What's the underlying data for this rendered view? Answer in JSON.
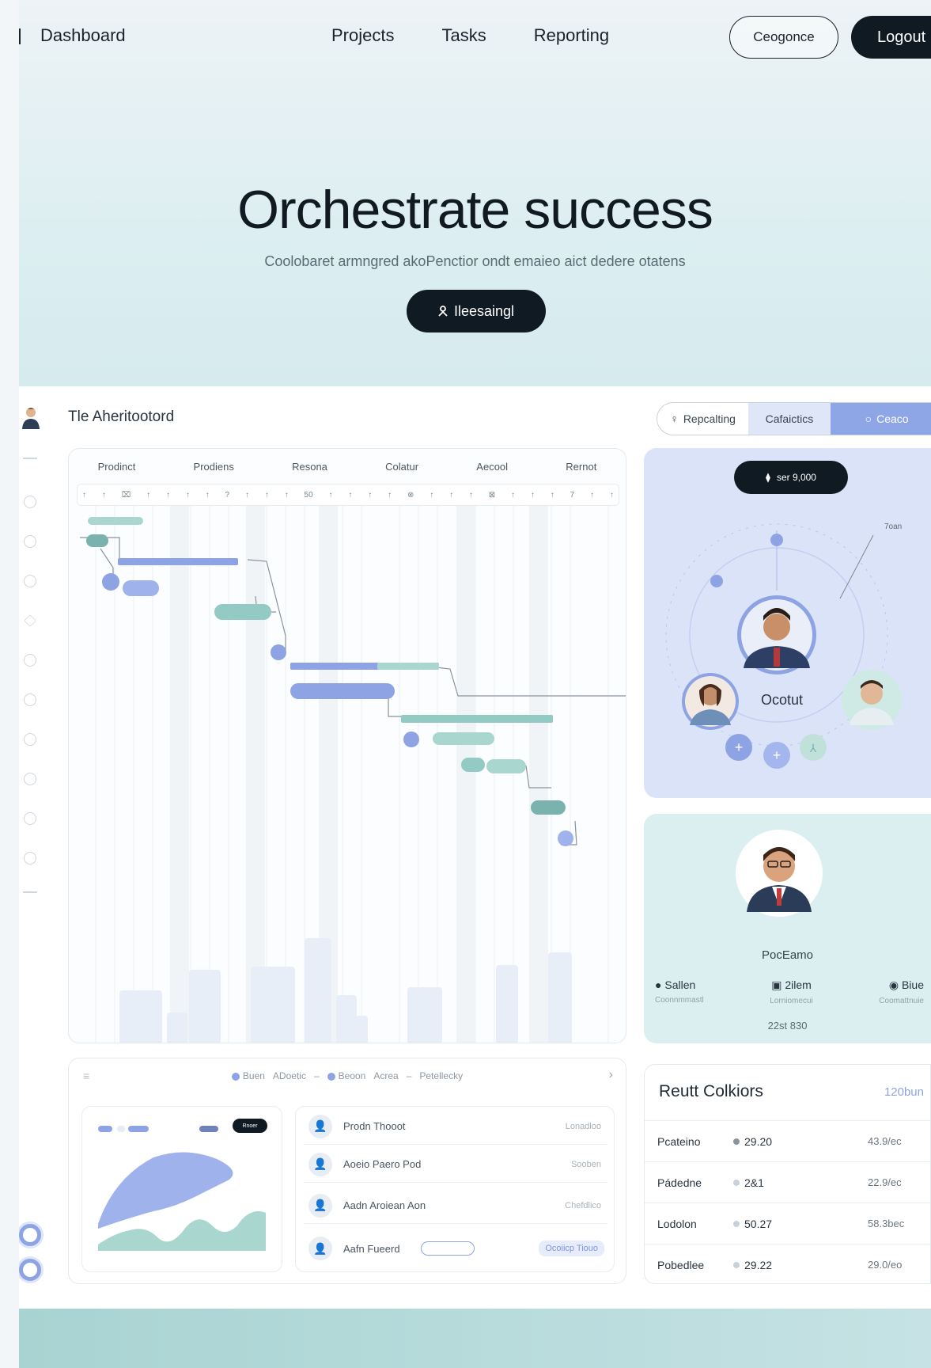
{
  "nav": {
    "brand": "Dashboard",
    "links": [
      "Projects",
      "Tasks",
      "Reporting"
    ],
    "outline_button": "Ceogonce",
    "dark_button": "Logout"
  },
  "hero": {
    "title": "Orchestrate success",
    "subtitle": "Coolobaret armngred akoPenctior ondt emaieo aict dedere otatens",
    "cta_label": "Ileesaingl",
    "cta_icon": "person-icon"
  },
  "dashboard": {
    "title": "Tle Aheritootord",
    "segments": [
      "Repcalting",
      "Cafaictics",
      "Ceaco"
    ],
    "gantt": {
      "columns": [
        "Prodinct",
        "Prodiens",
        "Resona",
        "Colatur",
        "Aecool",
        "Rernot"
      ],
      "tick_marks": [
        "↑",
        "↑",
        "⌧",
        "↑",
        "↑",
        "↑",
        "↑",
        "?",
        "↑",
        "↑",
        "↑",
        "50",
        "↑",
        "↑",
        "↑",
        "↑",
        "⊗",
        "↑",
        "↑",
        "↑",
        "⊠",
        "↑",
        "↑",
        "↑",
        "7",
        "↑",
        "↑"
      ]
    },
    "orbit": {
      "pill_text": "ser 9,000",
      "center_label": "Ocotut",
      "corner_label": "7oan"
    },
    "profile": {
      "name": "PocEamo",
      "stats": [
        {
          "icon": "person-icon",
          "label": "Sallen",
          "sub": "Coonnmmastl"
        },
        {
          "icon": "calendar-icon",
          "label": "2ilem",
          "sub": "Lorniomecui"
        },
        {
          "icon": "chat-icon",
          "label": "Biue",
          "sub": "Coomattnuie"
        }
      ],
      "footer": "22st 830"
    },
    "bottom": {
      "legend": [
        "Buen",
        "ADoetic",
        "Beoon",
        "Acrea",
        "Petellecky"
      ],
      "mini_badge": "Rnoer",
      "list": [
        {
          "name": "Prodn Thooot",
          "secondary": "Lonadloo"
        },
        {
          "name": "Aoeio Paero Pod",
          "secondary": "Sooben"
        },
        {
          "name": "Aadn Aroiean Aon",
          "secondary": "Chefdlico"
        },
        {
          "name": "Aafn Fueerd",
          "secondary": "Ocoiicp Tiouo"
        }
      ]
    },
    "table": {
      "title": "Reutt Colkiors",
      "total": "120bun",
      "rows": [
        {
          "name": "Pcateino",
          "value": "29.20",
          "extra": "43.9/ec"
        },
        {
          "name": "Pádedne",
          "value": "2&1",
          "extra": "22.9/ec"
        },
        {
          "name": "Lodolon",
          "value": "50.27",
          "extra": "58.3bec"
        },
        {
          "name": "Pobedlee",
          "value": "29.22",
          "extra": "29.0/eo"
        }
      ]
    }
  },
  "colors": {
    "accent_blue": "#8ea3e3",
    "accent_teal": "#93cbc4",
    "dark": "#0f1a23"
  }
}
